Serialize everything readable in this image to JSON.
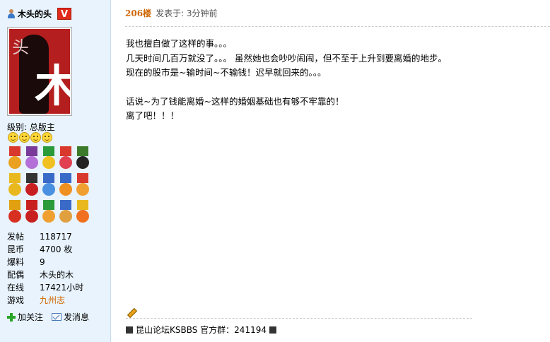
{
  "user": {
    "name": "木头的头",
    "vip_badge": "V",
    "avatar_text_top": "头",
    "avatar_text_big": "木",
    "level_label": "级别: 总版主",
    "smiley_count": 4
  },
  "medals": [
    {
      "ribbon": "#d8392c",
      "disc": "#e9a11f"
    },
    {
      "ribbon": "#7a3a9a",
      "disc": "#b470d8"
    },
    {
      "ribbon": "#2b9a3a",
      "disc": "#f0c020"
    },
    {
      "ribbon": "#d8392c",
      "disc": "#e04050"
    },
    {
      "ribbon": "#3a7a2a",
      "disc": "#222222"
    },
    {
      "ribbon": "#e9b81f",
      "disc": "#e9b81f"
    },
    {
      "ribbon": "#333333",
      "disc": "#c82020"
    },
    {
      "ribbon": "#3a6ac8",
      "disc": "#4a90e0"
    },
    {
      "ribbon": "#3a6ac8",
      "disc": "#f09020"
    },
    {
      "ribbon": "#d8392c",
      "disc": "#f0a030"
    },
    {
      "ribbon": "#e0a010",
      "disc": "#d83020"
    },
    {
      "ribbon": "#c82020",
      "disc": "#c82020"
    },
    {
      "ribbon": "#2b9a3a",
      "disc": "#f0a030"
    },
    {
      "ribbon": "#3a6ac8",
      "disc": "#e0a040"
    },
    {
      "ribbon": "#e9b81f",
      "disc": "#f07020"
    }
  ],
  "stats": [
    {
      "key": "发帖",
      "value": "118717"
    },
    {
      "key": "昆币",
      "value": "4700 枚"
    },
    {
      "key": "爆料",
      "value": "9"
    },
    {
      "key": "配偶",
      "value": "木头的木"
    },
    {
      "key": "在线",
      "value": "17421小时"
    }
  ],
  "game": {
    "key": "游戏",
    "value": "九州志"
  },
  "actions": {
    "follow": "加关注",
    "message": "发消息"
  },
  "post": {
    "floor": "206楼",
    "time": "发表于: 3分钟前",
    "lines": [
      "我也擅自做了这样的事。。。",
      "几天时间几百万就没了。。。 虽然她也会吵吵闹闹，但不至于上升到要离婚的地步。",
      "现在的股市是~输时间~不输钱！迟早就回来的。。。",
      "",
      "话说~为了钱能离婚~这样的婚姻基础也有够不牢靠的！",
      "离了吧！！！"
    ],
    "signature": "昆山论坛KSBBS 官方群：241194"
  },
  "colors": {
    "sidebar_bg": "#e8f3fd",
    "accent_orange": "#d06600",
    "vip_red": "#e02a1b"
  }
}
